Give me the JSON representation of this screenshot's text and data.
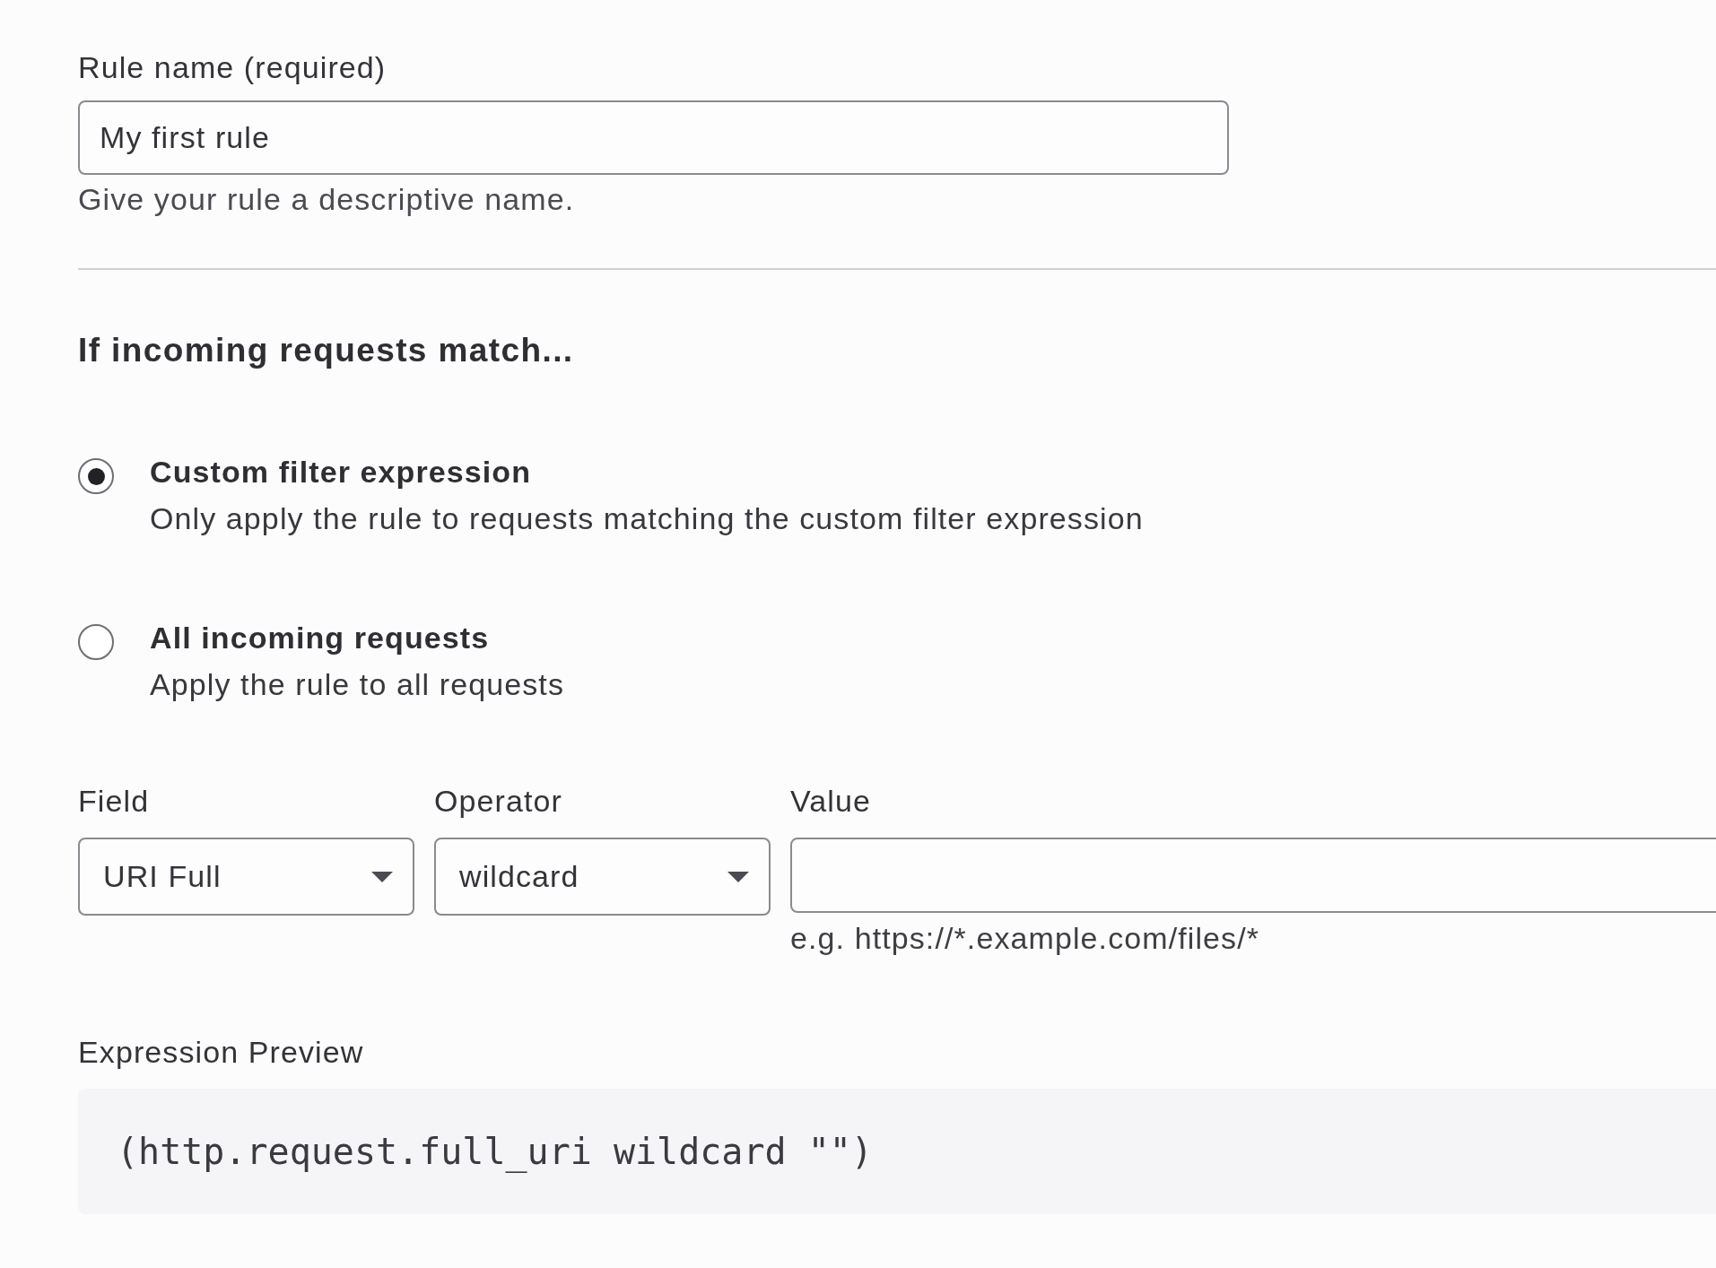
{
  "rule_name": {
    "label": "Rule name (required)",
    "value": "My first rule",
    "help": "Give your rule a descriptive name."
  },
  "section_heading": "If incoming requests match...",
  "match_options": [
    {
      "title": "Custom filter expression",
      "description": "Only apply the rule to requests matching the custom filter expression",
      "selected": true
    },
    {
      "title": "All incoming requests",
      "description": "Apply the rule to all requests",
      "selected": false
    }
  ],
  "filter_columns": [
    {
      "label": "Field",
      "kind": "select",
      "value": "URI Full"
    },
    {
      "label": "Operator",
      "kind": "select",
      "value": "wildcard"
    },
    {
      "label": "Value",
      "kind": "text",
      "hint": "e.g. https://*.example.com/files/*"
    }
  ],
  "expression_preview": {
    "label": "Expression Preview",
    "code": "(http.request.full_uri wildcard \"\")"
  }
}
